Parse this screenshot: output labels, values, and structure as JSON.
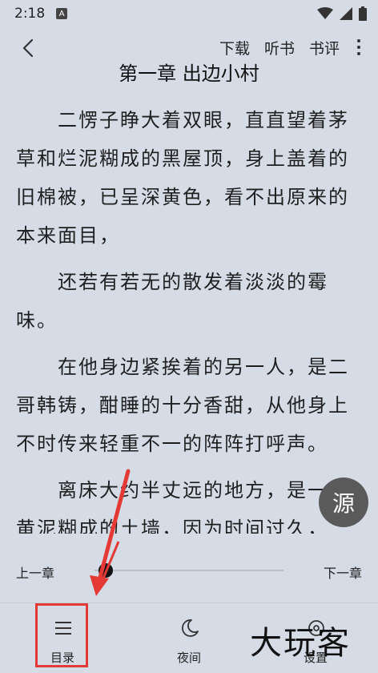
{
  "status_bar": {
    "time": "2:18",
    "notification_badge": "A"
  },
  "header": {
    "actions": [
      "下载",
      "听书",
      "书评"
    ]
  },
  "chapter": {
    "title": "第一章 出边小村",
    "paragraphs": [
      "二愣子睁大着双眼，直直望着茅草和烂泥糊成的黑屋顶，身上盖着的旧棉被，已呈深黄色，看不出原来的本来面目，",
      "还若有若无的散发着淡淡的霉味。",
      "在他身边紧挨着的另一人，是二哥韩铸，酣睡的十分香甜，从他身上不时传来轻重不一的阵阵打呼声。",
      "离床大约半丈远的地方，是一堵黄泥糊成的土墙，因为时间过久，"
    ]
  },
  "source_button": {
    "label": "源"
  },
  "chapter_nav": {
    "prev_label": "上一章",
    "next_label": "下一章",
    "progress": 0.02
  },
  "bottom_bar": {
    "items": [
      {
        "label": "目录",
        "icon": "menu-icon"
      },
      {
        "label": "夜间",
        "icon": "moon-icon"
      },
      {
        "label": "设置",
        "icon": "settings-icon"
      }
    ]
  },
  "watermark": {
    "text": "大玩客"
  },
  "colors": {
    "background": "#d5dce6",
    "highlight": "#e53935",
    "source_button": "#5a5a5a"
  }
}
